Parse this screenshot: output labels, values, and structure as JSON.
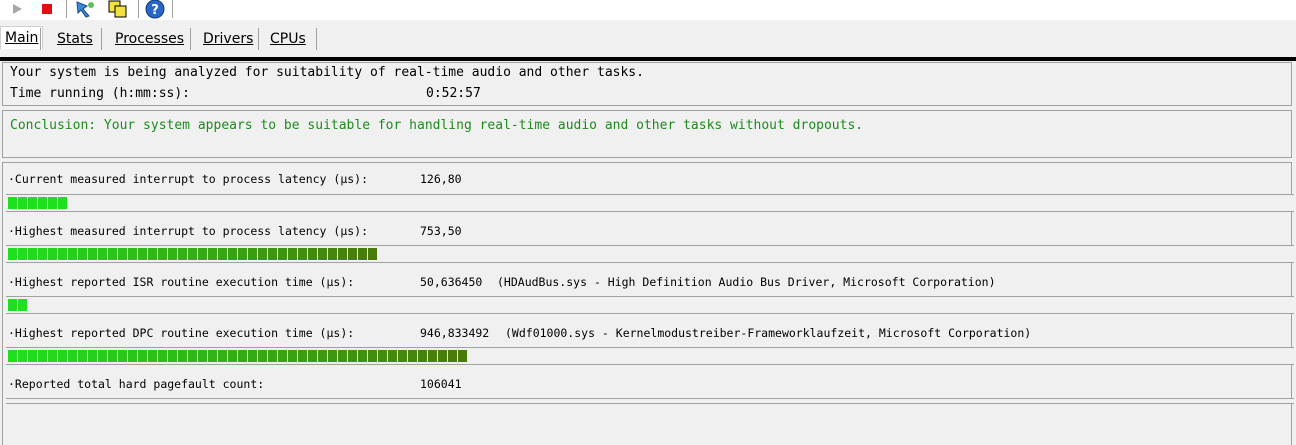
{
  "toolbar": {
    "buttons": [
      {
        "name": "start-icon"
      },
      {
        "name": "stop-icon"
      },
      {
        "name": "options-icon"
      },
      {
        "name": "copy-icon"
      },
      {
        "name": "help-icon"
      }
    ]
  },
  "tabs": [
    {
      "label": "Main",
      "active": true
    },
    {
      "label": "Stats",
      "active": false
    },
    {
      "label": "Processes",
      "active": false
    },
    {
      "label": "Drivers",
      "active": false
    },
    {
      "label": "CPUs",
      "active": false
    }
  ],
  "status": {
    "analysis_text": "Your system is being analyzed for suitability of real-time audio and other tasks.",
    "time_label": "Time running (h:mm:ss):",
    "time_value": "0:52:57"
  },
  "conclusion": {
    "text": "Conclusion: Your system appears to be suitable for handling real-time audio and other tasks without dropouts.",
    "color": "#1e8a1e"
  },
  "metrics": [
    {
      "label": "Current measured interrupt to process latency (µs):",
      "value": "126,80",
      "extra": "",
      "bar_segments": 6
    },
    {
      "label": "Highest measured interrupt to process latency (µs):",
      "value": "753,50",
      "extra": "",
      "bar_segments": 37
    },
    {
      "label": "Highest reported ISR routine execution time (µs):",
      "value": "50,636450",
      "extra": "(HDAudBus.sys - High Definition Audio Bus Driver, Microsoft Corporation)",
      "bar_segments": 2
    },
    {
      "label": "Highest reported DPC routine execution time (µs):",
      "value": "946,833492",
      "extra": "(Wdf01000.sys - Kernelmodustreiber-Frameworklaufzeit, Microsoft Corporation)",
      "bar_segments": 46
    },
    {
      "label": "Reported total hard pagefault count:",
      "value": "106041",
      "extra": "",
      "bar_segments": 0
    }
  ],
  "colors": {
    "bar_bright": "#1fe01f",
    "bar_dark": "#4a7a0a"
  }
}
